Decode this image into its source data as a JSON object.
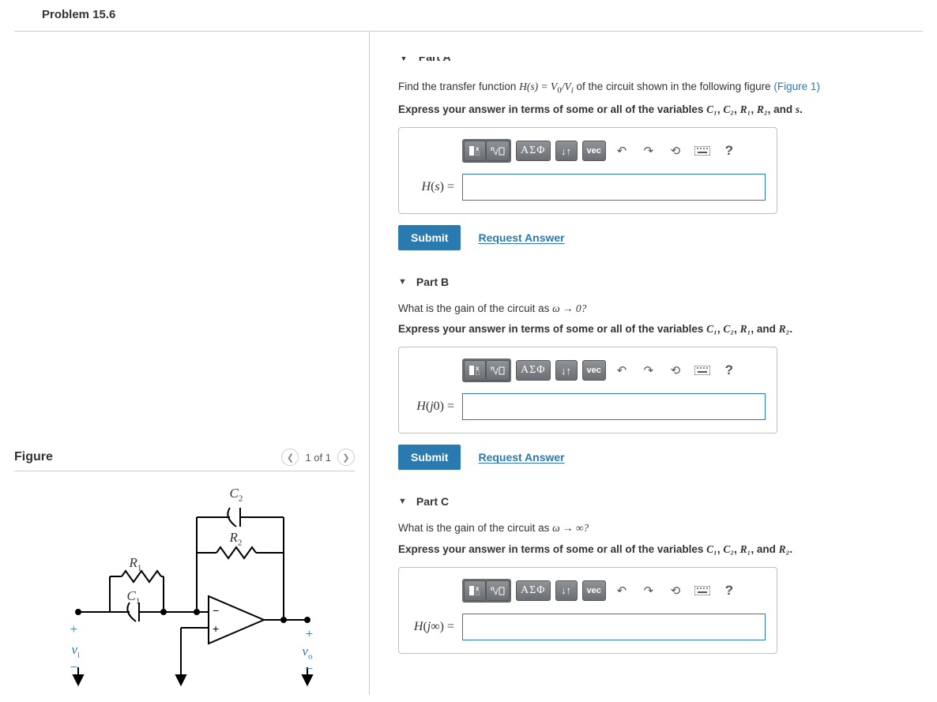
{
  "problem_title": "Problem 15.6",
  "figure": {
    "title": "Figure",
    "pager": "1 of 1",
    "labels": {
      "c2": "C",
      "c2_sub": "2",
      "r2": "R",
      "r2_sub": "2",
      "r1": "R",
      "r1_sub": "1",
      "c1": "C",
      "c1_sub": "1",
      "vi": "v",
      "vi_sub": "i",
      "vo": "v",
      "vo_sub": "o",
      "plus": "+",
      "minus": "−"
    }
  },
  "partA": {
    "title": "Part A",
    "prompt_pre": "Find the transfer function ",
    "prompt_math_lhs": "H(s) = V",
    "prompt_math_lhs_sub": "0",
    "prompt_math_mid": "/V",
    "prompt_math_mid_sub": "i",
    "prompt_post": " of the circuit shown in the following figure ",
    "figure_link": "(Figure 1)",
    "express_pre": "Express your answer in terms of some or all of the variables ",
    "vars": [
      "C₁",
      "C₂",
      "R₁",
      "R₂"
    ],
    "express_post": ", and ",
    "extra_var": "s",
    "period": ".",
    "label": "H(s) =",
    "submit": "Submit",
    "request": "Request Answer"
  },
  "partB": {
    "title": "Part B",
    "prompt_pre": "What is the gain of the circuit as ",
    "prompt_math": "ω → 0?",
    "express_pre": "Express your answer in terms of some or all of the variables ",
    "vars": [
      "C₁",
      "C₂",
      "R₁"
    ],
    "express_mid": ", and ",
    "last_var": "R₂",
    "period": ".",
    "label": "H(j0) =",
    "submit": "Submit",
    "request": "Request Answer"
  },
  "partC": {
    "title": "Part C",
    "prompt_pre": "What is the gain of the circuit as ",
    "prompt_math": "ω → ∞?",
    "express_pre": "Express your answer in terms of some or all of the variables ",
    "vars": [
      "C₁",
      "C₂",
      "R₁"
    ],
    "express_mid": ", and ",
    "last_var": "R₂",
    "period": ".",
    "label": "H(j∞) =",
    "submit": "Submit",
    "request": "Request Answer"
  },
  "toolbar": {
    "greek": "ΑΣΦ",
    "vec": "vec",
    "help": "?"
  }
}
